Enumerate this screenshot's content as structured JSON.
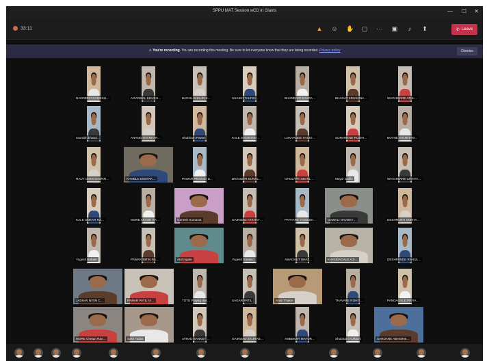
{
  "window": {
    "title": "SPPU MAT Session wCD in Giants",
    "controls": [
      "—",
      "☐",
      "✕"
    ]
  },
  "toolbar": {
    "timer": "33:11",
    "icons": [
      "alert-icon",
      "people-icon",
      "hand-icon",
      "chat-icon",
      "more-icon",
      "camera-icon",
      "mic-icon",
      "share-icon"
    ],
    "leave_label": "Leave"
  },
  "banner": {
    "bold": "You're recording.",
    "text": "You are recording this meeting. Be sure to let everyone know that they are being recorded.",
    "link": "Privacy policy",
    "dismiss": "Dismiss"
  },
  "participants": [
    [
      "RAVINDRA RAMESH…",
      "AGARWAL KHUSH…",
      "BAGUL SHALIN S…",
      "SHAIKH TAUFIK…",
      "BHANDARI SAURA…",
      "BHAGAT KRUSHNA…",
      "WAGHMARE ATUL…"
    ],
    [
      "saurabh bhand…",
      "ANAND SHANKAR…",
      "Shubham Pawar",
      "KALE SHUBHAM…",
      "LOKHANDE SACHI…",
      "SONAWANE RUSHI…",
      "BOTHE SHUBHAM…"
    ],
    [
      "RAUT OMKESHWAR…",
      "KAMBLE DEEPAK…",
      "PAWAR PRASAD D…",
      "BHANDAR KUNAL…",
      "GHOLAPE NIKHIL…",
      "Mayur Sable",
      "WAGHMARE CHAITA…"
    ],
    [
      "KALE ONKAR RA…",
      "MORE AKASH SA…",
      "Ganesh Kumavat",
      "GAIKWAD AKSHAY…",
      "PATHARE YOGESH…",
      "GAWALI NAVDEV…",
      "DESHMUKH SNEHA…"
    ],
    [
      "Yogesh Bahale",
      "PAWAR NITIN RA…",
      "Atul Ingole",
      "Yogesh Sonaw…",
      "AWADHUT BHAT…",
      "KHANDAGALE AJI…",
      "DESHPANDE RAHUL…"
    ],
    [
      "JADHAV NITIN C…",
      "PAWAR PATIL VI…",
      "TOTE Prayag Vak…",
      "SAGAR PATIL",
      "Ankit Thakre",
      "THAVARE ROHIT…",
      "PANDAGALE PRIYA…"
    ],
    [
      "MORE Chetan Rav…",
      "Sahil Tadas",
      "AVHAD SANKET …",
      "GAIKWAD SAURAB…",
      "AMBEKAR MAYUR…",
      "Shubham Kulkarni",
      "SARDARE ABHISHE…"
    ]
  ],
  "colors": {
    "background": "#0f0f0f",
    "banner": "#2b2c44",
    "leave_button": "#c4314b"
  }
}
